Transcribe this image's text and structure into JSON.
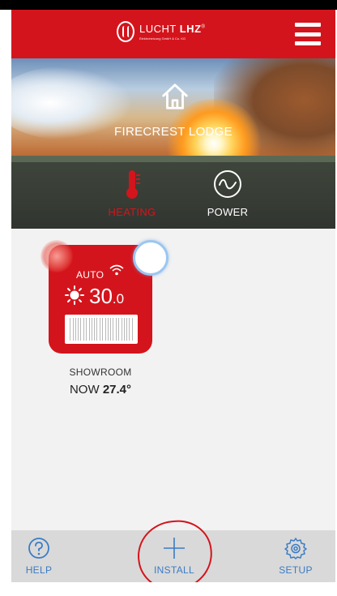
{
  "header": {
    "brand_name": "LUCHT",
    "brand_bold": "LHZ",
    "brand_reg": "®",
    "brand_sub": "Elektroheizung GmbH & Co. KG",
    "menu_icon": "hamburger-menu-icon"
  },
  "hero": {
    "home_icon": "home-icon",
    "title": "FIRECREST LODGE",
    "modes": [
      {
        "label": "HEATING",
        "icon": "thermometer-icon",
        "active": true
      },
      {
        "label": "POWER",
        "icon": "wave-icon",
        "active": false
      }
    ]
  },
  "devices": [
    {
      "mode": "AUTO",
      "set_temp_main": "30",
      "set_temp_decimal": ".0",
      "name": "SHOWROOM",
      "now_label": "NOW",
      "now_value": "27.4°"
    }
  ],
  "bottom_nav": {
    "help": "HELP",
    "install": "INSTALL",
    "setup": "SETUP"
  },
  "colors": {
    "brand_red": "#d4141c",
    "nav_blue": "#3a7cc5",
    "bottom_bar": "#d9d9d9",
    "background": "#f2f2f2"
  }
}
